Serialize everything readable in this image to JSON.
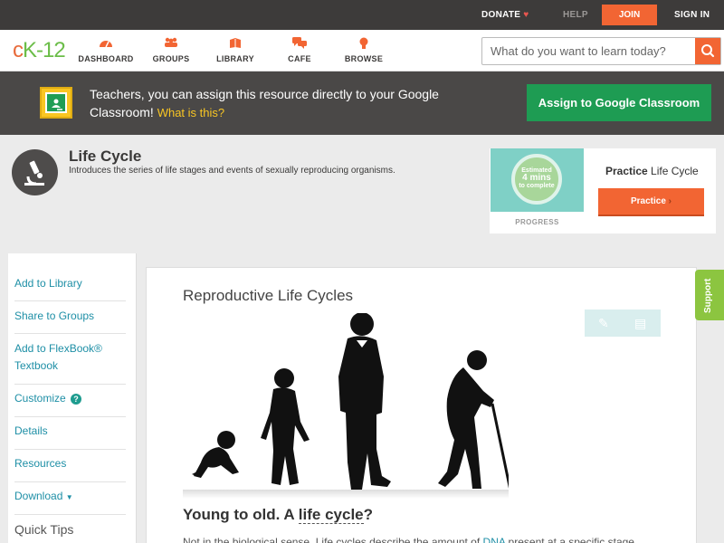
{
  "topbar": {
    "donate": "DONATE",
    "help": "HELP",
    "join": "JOIN",
    "sign_in": "SIGN IN"
  },
  "navbar": {
    "logo_c": "c",
    "logo_k": "K",
    "logo_n": "-12",
    "items": [
      {
        "label": "DASHBOARD",
        "icon": "gauge-icon"
      },
      {
        "label": "GROUPS",
        "icon": "people-icon"
      },
      {
        "label": "LIBRARY",
        "icon": "book-icon"
      },
      {
        "label": "CAFE",
        "icon": "chat-icon"
      },
      {
        "label": "BROWSE",
        "icon": "lightbulb-icon"
      }
    ],
    "search_placeholder": "What do you want to learn today?"
  },
  "banner": {
    "text": "Teachers, you can assign this resource directly to your Google Classroom!",
    "link": "What is this?",
    "button": "Assign to Google Classroom"
  },
  "resource": {
    "title": "Life Cycle",
    "description": "Introduces the series of life stages and events of sexually reproducing organisms."
  },
  "practice": {
    "estimated": "Estimated",
    "mins": "4 mins",
    "to_complete": "to complete",
    "progress_label": "PROGRESS",
    "title_bold": "Practice",
    "title_rest": "Life Cycle",
    "button": "Practice"
  },
  "sidebar": {
    "items": [
      {
        "label": "Add to Library"
      },
      {
        "label": "Share to Groups"
      },
      {
        "label": "Add to FlexBook® Textbook"
      },
      {
        "label": "Customize"
      },
      {
        "label": "Details"
      },
      {
        "label": "Resources"
      },
      {
        "label": "Download"
      }
    ],
    "quick_tips": "Quick Tips"
  },
  "content": {
    "section_title": "Reproductive Life Cycles",
    "heading_prefix": "Young to old. A ",
    "heading_link": "life cycle",
    "heading_suffix": "?",
    "body_prefix": "Not in the biological sense. Life cycles describe the amount of ",
    "body_link": "DNA",
    "body_suffix": " present at a specific stage."
  },
  "support_tab": "Support",
  "colors": {
    "accent_orange": "#f26533",
    "google_green": "#1e9c53",
    "link_teal": "#1e8fa6",
    "support_green": "#8cc540"
  }
}
